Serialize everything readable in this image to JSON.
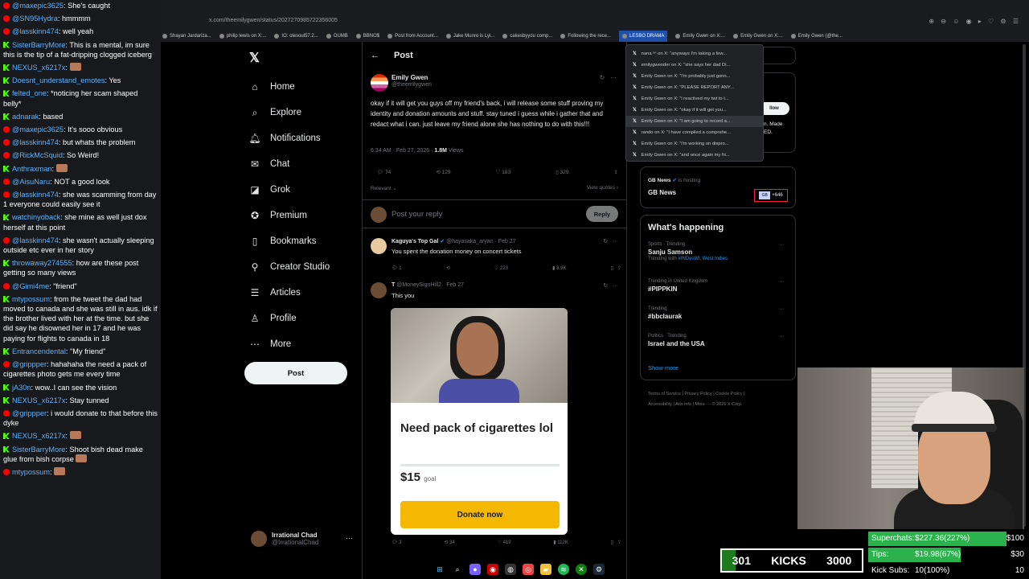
{
  "chat": [
    {
      "platform": "yt",
      "user": "@maxepic3625",
      "color": "#5fb3ff",
      "text": "She's caught"
    },
    {
      "platform": "yt",
      "user": "@SN95Hydra",
      "color": "#5fb3ff",
      "text": "hmmmm"
    },
    {
      "platform": "yt",
      "user": "@lasskinn474",
      "color": "#5fb3ff",
      "text": "well yeah"
    },
    {
      "platform": "kick",
      "user": "SisterBarryMore",
      "color": "#5fb3ff",
      "text": "This is a mental, im sure this is the tip of a fat-dripping clogged iceberg"
    },
    {
      "platform": "kick",
      "user": "NEXUS_x6217x",
      "color": "#5fb3ff",
      "text": "",
      "emote": true
    },
    {
      "platform": "kick",
      "user": "Doesnt_understand_emotes",
      "color": "#5fb3ff",
      "text": "Yes"
    },
    {
      "platform": "kick",
      "user": "felted_one",
      "color": "#5fb3ff",
      "text": "*noticing her scam shaped belly*"
    },
    {
      "platform": "kick",
      "user": "adnarak",
      "color": "#5fb3ff",
      "text": "based"
    },
    {
      "platform": "yt",
      "user": "@maxepic3625",
      "color": "#5fb3ff",
      "text": "It's sooo obvious"
    },
    {
      "platform": "yt",
      "user": "@lasskinn474",
      "color": "#5fb3ff",
      "text": "but whats the problem"
    },
    {
      "platform": "yt",
      "user": "@RickMcSquid",
      "color": "#5fb3ff",
      "text": "So Weird!"
    },
    {
      "platform": "kick",
      "user": "Anthraxman",
      "color": "#5fb3ff",
      "text": "",
      "emote": true
    },
    {
      "platform": "yt",
      "user": "@AisuNaru",
      "color": "#5fb3ff",
      "text": "NOT a good look"
    },
    {
      "platform": "yt",
      "user": "@lasskinn474",
      "color": "#5fb3ff",
      "text": "she was scamming from day 1 everyone could easily see it"
    },
    {
      "platform": "kick",
      "user": "watchinyoback",
      "color": "#5fb3ff",
      "text": "she mine as well just dox herself at this point"
    },
    {
      "platform": "yt",
      "user": "@lasskinn474",
      "color": "#5fb3ff",
      "text": "she wasn't actually sleeping outside etc ever in her story"
    },
    {
      "platform": "kick",
      "user": "throwaway274555",
      "color": "#5fb3ff",
      "text": "how are these post getting so many views"
    },
    {
      "platform": "yt",
      "user": "@Gimi4me",
      "color": "#5fb3ff",
      "text": "\"friend\""
    },
    {
      "platform": "kick",
      "user": "mtypossum",
      "color": "#5fb3ff",
      "text": "from the tweet the dad had moved to canada and she was still in aus. idk if the brother lived with her at the time. but she did say he disowned her in 17 and he was paying for flights to canada in 18"
    },
    {
      "platform": "kick",
      "user": "Entrancendental",
      "color": "#5fb3ff",
      "text": "\"My friend\""
    },
    {
      "platform": "yt",
      "user": "@grippper",
      "color": "#5fb3ff",
      "text": "hahahaha the need a pack of cigarettes photo gets me every time"
    },
    {
      "platform": "kick",
      "user": "jA30n",
      "color": "#5fb3ff",
      "text": "wow..I can see the vision"
    },
    {
      "platform": "kick",
      "user": "NEXUS_x6217x",
      "color": "#5fb3ff",
      "text": "Stay tunned"
    },
    {
      "platform": "yt",
      "user": "@grippper",
      "color": "#5fb3ff",
      "text": "i would donate to that before this dyke"
    },
    {
      "platform": "kick",
      "user": "NEXUS_x6217x",
      "color": "#5fb3ff",
      "text": "",
      "emote": true
    },
    {
      "platform": "kick",
      "user": "SisterBarryMore",
      "color": "#5fb3ff",
      "text": "Shoot bish dead make glue from bish corpse",
      "emote": true
    },
    {
      "platform": "yt",
      "user": "mtypossum",
      "color": "#5fb3ff",
      "text": "",
      "emote": true
    }
  ],
  "browser": {
    "url": "x.com/theemilygwen/status/2027270985722356005",
    "bookmarks": [
      "Shayan Jardariza...",
      "philip lewis on X:...",
      "IO: olesoul57.2...",
      "OUMB",
      "BBNO$",
      "Post from Account...",
      "Jake Munro is Lyi...",
      "cakesbyyou comp...",
      "Following the rece...",
      "LESBO DRAMA",
      "Emily Gwen on X:...",
      "Emily Gwen on X:...",
      "Emily Gwen (@the..."
    ],
    "active_bookmark": "LESBO DRAMA"
  },
  "nav": {
    "items": [
      {
        "label": "Home",
        "icon": "home-icon",
        "glyph": "⌂"
      },
      {
        "label": "Explore",
        "icon": "search-icon",
        "glyph": "⌕"
      },
      {
        "label": "Notifications",
        "icon": "bell-icon",
        "glyph": "🔔︎"
      },
      {
        "label": "Chat",
        "icon": "mail-icon",
        "glyph": "✉"
      },
      {
        "label": "Grok",
        "icon": "grok-icon",
        "glyph": "◪"
      },
      {
        "label": "Premium",
        "icon": "premium-icon",
        "glyph": "✪"
      },
      {
        "label": "Bookmarks",
        "icon": "bookmark-icon",
        "glyph": "▯"
      },
      {
        "label": "Creator Studio",
        "icon": "creator-icon",
        "glyph": "⚲"
      },
      {
        "label": "Articles",
        "icon": "articles-icon",
        "glyph": "☰"
      },
      {
        "label": "Profile",
        "icon": "profile-icon",
        "glyph": "♙"
      },
      {
        "label": "More",
        "icon": "more-icon",
        "glyph": "⋯"
      }
    ],
    "post_label": "Post",
    "profile": {
      "name": "Irrational Chad",
      "handle": "@IrrationalChad"
    }
  },
  "main": {
    "title": "Post",
    "tweet": {
      "name": "Emily Gwen",
      "handle": "@theemilygwen",
      "text": "okay if it will get you guys off my friend's back, i will release some stuff proving my identity and donation amounts and stuff. stay tuned i guess while i gather that and redact what i can. just leave my friend alone she has nothing to do with this!!!",
      "time": "6:34 AM · Feb 27, 2026 ·",
      "views": "1.8M",
      "views_label": "Views",
      "replies": "74",
      "reposts": "129",
      "likes": "183",
      "bookmarks": "329",
      "relevant": "Relevant ⌄",
      "view_quotes": "View quotes ›"
    },
    "reply_box": {
      "placeholder": "Post your reply",
      "button": "Reply"
    },
    "replies": [
      {
        "name": "Kaguya's Top Gal",
        "handle": "@hayasaka_aryan · Feb 27",
        "text": "You spent the donation money on concert tickets",
        "replies": "1",
        "reposts": "",
        "likes": "223",
        "views": "3.9K"
      },
      {
        "name": "T",
        "handle": "@MoneySignHill2 · Feb 27",
        "text": "This you",
        "replies": "3",
        "reposts": "34",
        "likes": "419",
        "views": "112K"
      }
    ],
    "card": {
      "title": "Need pack of cigarettes lol",
      "amount": "$15",
      "goal_label": "goal",
      "progress": 0.0,
      "donate": "Donate now"
    }
  },
  "history_dropdown": [
    "nana ᵒⁿ on X: \"anyways I'm taking a few...",
    "emilygwender on X: \"she says her dad Di...",
    "Emily Gwen on X: \"i'm probably just gonn...",
    "Emily Gwen on X: \"PLEASE REPORT ANY...",
    "Emily Gwen on X: \"i reactived my twt to t...",
    "Emily Gwen on X: \"okay if it will get you...",
    "Emily Gwen on X: \"I am going to record a...",
    "rando on X: \"I have compiled a comprehe...",
    "Emily Gwen on X: \"i'm working on dispro...",
    "Emily Gwen on X: \"and once again my fri..."
  ],
  "right": {
    "follow": "llow",
    "snippet": [
      "n. Made",
      "ED."
    ],
    "gbnews": {
      "label": "GB News",
      "hosting": "is hosting",
      "title": "GB News",
      "badge": "GB",
      "count": "+646"
    },
    "whats_happening": "What's happening",
    "trends": [
      {
        "ctx": "Sports · Trending",
        "name": "Sanju Samson",
        "sub_prefix": "Trending with",
        "sub_links": "#INDvsWI, West Indies"
      },
      {
        "ctx": "Trending in United Kingdom",
        "name": "#PIPPKIN",
        "sub_prefix": "",
        "sub_links": ""
      },
      {
        "ctx": "Trending",
        "name": "#bbclaurak",
        "sub_prefix": "",
        "sub_links": ""
      },
      {
        "ctx": "Politics · Trending",
        "name": "Israel and the USA",
        "sub_prefix": "",
        "sub_links": ""
      }
    ],
    "show_more": "Show more",
    "footer": [
      "Terms of Service | Privacy Policy | Cookie Policy |",
      "Accessibility | Ads info | More ··· © 2026 X Corp."
    ]
  },
  "overlay": {
    "kicks": {
      "current": "301",
      "label": "KICKS",
      "goal": "3000",
      "progress": 0.1
    },
    "stats": [
      {
        "label": "Superchats:",
        "value": "$227.36(227%)",
        "goal": "$100",
        "progress": 1.0
      },
      {
        "label": "Tips:",
        "value": "$19.98(67%)",
        "goal": "$30",
        "progress": 0.67
      },
      {
        "label": "Kick Subs:",
        "value": "10(100%)",
        "goal": "10",
        "progress": 0.0
      }
    ]
  },
  "colors": {
    "accent": "#1d9bf0",
    "kick_green": "#53fc18",
    "youtube_red": "#ff0000"
  }
}
